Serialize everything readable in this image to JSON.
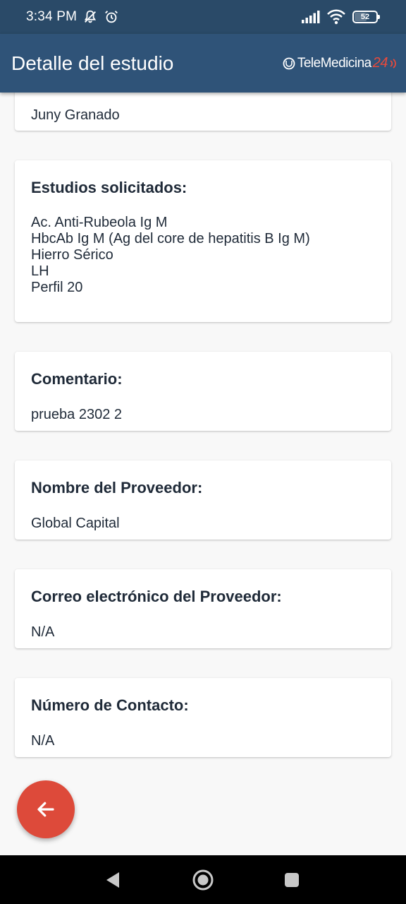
{
  "status_bar": {
    "time": "3:34 PM",
    "battery": "52",
    "icons": [
      "notifications-muted-icon",
      "alarm-icon",
      "signal-icon",
      "wifi-icon",
      "battery-icon"
    ]
  },
  "app_bar": {
    "title": "Detalle del estudio",
    "brand_text": "TeleMedicina",
    "brand_number": "24"
  },
  "cards": {
    "top_partial": {
      "value": "Juny Granado"
    },
    "estudios": {
      "title": "Estudios solicitados:",
      "items": [
        "Ac. Anti-Rubeola Ig M",
        "HbcAb Ig M (Ag del core de hepatitis B Ig M)",
        "Hierro Sérico",
        "LH",
        "Perfil 20"
      ]
    },
    "comentario": {
      "title": "Comentario:",
      "value": "prueba 2302 2"
    },
    "proveedor": {
      "title": "Nombre del Proveedor:",
      "value": "Global Capital"
    },
    "correo": {
      "title": "Correo electrónico del Proveedor:",
      "value": "N/A"
    },
    "contacto": {
      "title": "Número de Contacto:",
      "value": "N/A"
    }
  },
  "fab": {
    "icon": "arrow-back-icon"
  },
  "nav_bar": {
    "icons": [
      "back-triangle-icon",
      "home-circle-icon",
      "recents-square-icon"
    ]
  },
  "colors": {
    "status_bar": "#2a4a68",
    "app_bar": "#2f5378",
    "accent": "#dd4a3a",
    "text": "#1f2a38",
    "background": "#f8f8f8"
  }
}
